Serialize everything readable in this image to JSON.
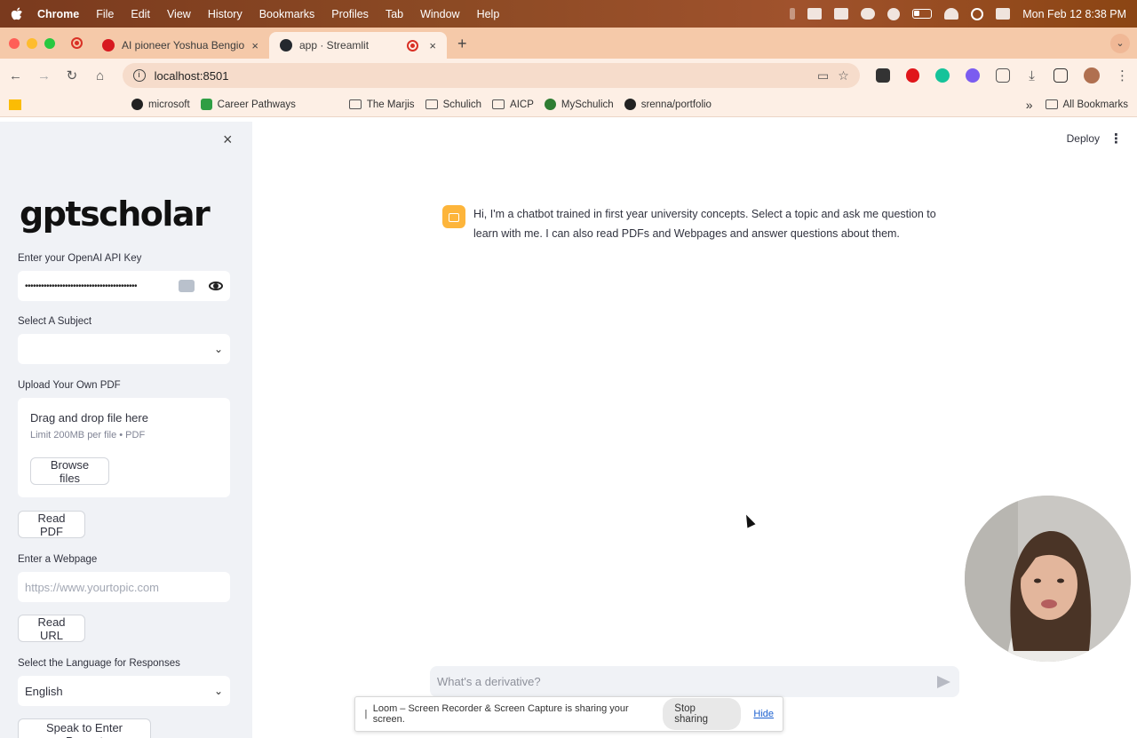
{
  "menubar": {
    "app": "Chrome",
    "items": [
      "File",
      "Edit",
      "View",
      "History",
      "Bookmarks",
      "Profiles",
      "Tab",
      "Window",
      "Help"
    ],
    "clock": "Mon Feb 12  8:38 PM"
  },
  "tabs": [
    {
      "title": "AI pioneer Yoshua Bengio urg",
      "close": "×"
    },
    {
      "title": "app · Streamlit",
      "close": "×"
    }
  ],
  "toolbar": {
    "url": "localhost:8501"
  },
  "bookmarks": {
    "items": [
      "microsoft",
      "Career Pathways",
      "The Marjis",
      "Schulich",
      "AICP",
      "MySchulich",
      "srenna/portfolio"
    ],
    "overflow": "»",
    "all": "All Bookmarks"
  },
  "sidebar": {
    "close": "×",
    "logo": "gptscholar",
    "api_key_label": "Enter your OpenAI API Key",
    "api_key_value": "••••••••••••••••••••••••••••••••••••••••••",
    "subject_label": "Select A Subject",
    "subject_value": "",
    "pdf_label": "Upload Your Own PDF",
    "dropzone_title": "Drag and drop file here",
    "dropzone_limit": "Limit 200MB per file • PDF",
    "browse_button": "Browse files",
    "read_pdf_button": "Read PDF",
    "webpage_label": "Enter a Webpage",
    "webpage_placeholder": "https://www.yourtopic.com",
    "read_url_button": "Read URL",
    "language_label": "Select the Language for Responses",
    "language_value": "English",
    "speak_button": "Speak to Enter Prompt"
  },
  "main": {
    "deploy": "Deploy",
    "menu_icon": "⋮",
    "assistant_message": "Hi, I'm a chatbot trained in first year university concepts. Select a topic and ask me question to learn with me. I can also read PDFs and Webpages and answer questions about them.",
    "chat_placeholder": "What's a derivative?"
  },
  "loom_bar": {
    "text": "Loom – Screen Recorder & Screen Capture is sharing your screen.",
    "stop": "Stop sharing",
    "hide": "Hide"
  },
  "colors": {
    "sidebar_bg": "#f0f2f6",
    "bot_avatar": "#fdb53b",
    "loom_link": "#1a5fd0"
  }
}
